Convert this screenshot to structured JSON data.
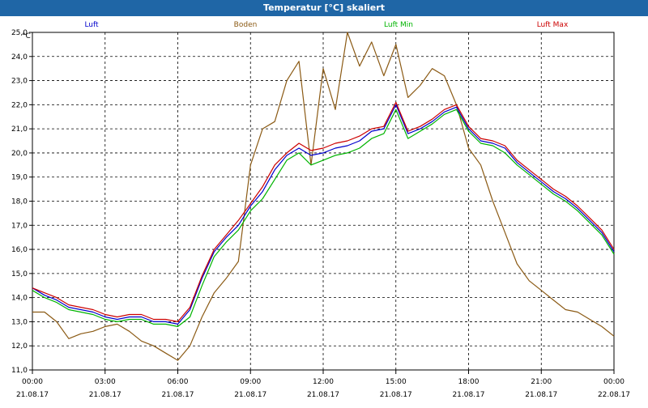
{
  "window": {
    "title": "Temperatur [°C] skaliert"
  },
  "chart_data": {
    "type": "line",
    "title": "Temperatur [°C] skaliert",
    "ylabel": "°C",
    "ylim": [
      11.0,
      25.0
    ],
    "yticks": [
      "11,0",
      "12,0",
      "13,0",
      "14,0",
      "15,0",
      "16,0",
      "17,0",
      "18,0",
      "19,0",
      "20,0",
      "21,0",
      "22,0",
      "23,0",
      "24,0",
      "25,0"
    ],
    "xlim": [
      0,
      24
    ],
    "xticks": [
      {
        "time": "00:00",
        "date": "21.08.17"
      },
      {
        "time": "03:00",
        "date": "21.08.17"
      },
      {
        "time": "06:00",
        "date": "21.08.17"
      },
      {
        "time": "09:00",
        "date": "21.08.17"
      },
      {
        "time": "12:00",
        "date": "21.08.17"
      },
      {
        "time": "15:00",
        "date": "21.08.17"
      },
      {
        "time": "18:00",
        "date": "21.08.17"
      },
      {
        "time": "21:00",
        "date": "21.08.17"
      },
      {
        "time": "00:00",
        "date": "22.08.17"
      }
    ],
    "grid": true,
    "legend_position": "top",
    "series": [
      {
        "name": "Luft",
        "color": "#0000cc",
        "x": [
          0,
          0.5,
          1,
          1.5,
          2,
          2.5,
          3,
          3.5,
          4,
          4.5,
          5,
          5.5,
          6,
          6.5,
          7,
          7.5,
          8,
          8.5,
          9,
          9.5,
          10,
          10.5,
          11,
          11.5,
          12,
          12.5,
          13,
          13.5,
          14,
          14.5,
          15,
          15.5,
          16,
          16.5,
          17,
          17.5,
          18,
          18.5,
          19,
          19.5,
          20,
          20.5,
          21,
          21.5,
          22,
          22.5,
          23,
          23.5,
          24
        ],
        "y": [
          14.4,
          14.1,
          13.9,
          13.6,
          13.5,
          13.4,
          13.2,
          13.1,
          13.2,
          13.2,
          13.0,
          13.0,
          12.9,
          13.5,
          14.8,
          15.9,
          16.5,
          17.0,
          17.8,
          18.4,
          19.3,
          19.9,
          20.2,
          19.9,
          20.0,
          20.2,
          20.3,
          20.5,
          20.9,
          21.0,
          22.0,
          20.8,
          21.0,
          21.3,
          21.7,
          21.9,
          21.0,
          20.5,
          20.4,
          20.2,
          19.6,
          19.2,
          18.8,
          18.4,
          18.1,
          17.7,
          17.2,
          16.7,
          15.9
        ]
      },
      {
        "name": "Boden",
        "color": "#8b5a14",
        "x": [
          0,
          0.5,
          1,
          1.5,
          2,
          2.5,
          3,
          3.5,
          4,
          4.5,
          5,
          5.5,
          6,
          6.5,
          7,
          7.5,
          8,
          8.5,
          9,
          9.5,
          10,
          10.5,
          11,
          11.5,
          12,
          12.5,
          13,
          13.5,
          14,
          14.5,
          15,
          15.5,
          16,
          16.5,
          17,
          17.5,
          18,
          18.5,
          19,
          19.5,
          20,
          20.5,
          21,
          21.5,
          22,
          22.5,
          23,
          23.5,
          24
        ],
        "y": [
          13.4,
          13.4,
          13.0,
          12.3,
          12.5,
          12.6,
          12.8,
          12.9,
          12.6,
          12.2,
          12.0,
          11.7,
          11.4,
          12.0,
          13.2,
          14.2,
          14.8,
          15.5,
          19.5,
          21.0,
          21.3,
          23.0,
          23.8,
          19.5,
          23.5,
          21.8,
          25.0,
          23.6,
          24.6,
          23.2,
          24.5,
          22.3,
          22.8,
          23.5,
          23.2,
          22.0,
          20.2,
          19.5,
          18.0,
          16.7,
          15.4,
          14.7,
          14.3,
          13.9,
          13.5,
          13.4,
          13.1,
          12.8,
          12.4
        ]
      },
      {
        "name": "Luft Min",
        "color": "#00b400",
        "x": [
          0,
          0.5,
          1,
          1.5,
          2,
          2.5,
          3,
          3.5,
          4,
          4.5,
          5,
          5.5,
          6,
          6.5,
          7,
          7.5,
          8,
          8.5,
          9,
          9.5,
          10,
          10.5,
          11,
          11.5,
          12,
          12.5,
          13,
          13.5,
          14,
          14.5,
          15,
          15.5,
          16,
          16.5,
          17,
          17.5,
          18,
          18.5,
          19,
          19.5,
          20,
          20.5,
          21,
          21.5,
          22,
          22.5,
          23,
          23.5,
          24
        ],
        "y": [
          14.3,
          14.0,
          13.8,
          13.5,
          13.4,
          13.3,
          13.1,
          13.0,
          13.1,
          13.1,
          12.9,
          12.9,
          12.8,
          13.2,
          14.5,
          15.7,
          16.3,
          16.8,
          17.6,
          18.1,
          18.9,
          19.7,
          20.0,
          19.5,
          19.7,
          19.9,
          20.0,
          20.2,
          20.6,
          20.8,
          21.8,
          20.6,
          20.9,
          21.2,
          21.6,
          21.8,
          20.9,
          20.4,
          20.3,
          20.0,
          19.5,
          19.1,
          18.7,
          18.3,
          18.0,
          17.6,
          17.1,
          16.6,
          15.8
        ]
      },
      {
        "name": "Luft Max",
        "color": "#cc0000",
        "x": [
          0,
          0.5,
          1,
          1.5,
          2,
          2.5,
          3,
          3.5,
          4,
          4.5,
          5,
          5.5,
          6,
          6.5,
          7,
          7.5,
          8,
          8.5,
          9,
          9.5,
          10,
          10.5,
          11,
          11.5,
          12,
          12.5,
          13,
          13.5,
          14,
          14.5,
          15,
          15.5,
          16,
          16.5,
          17,
          17.5,
          18,
          18.5,
          19,
          19.5,
          20,
          20.5,
          21,
          21.5,
          22,
          22.5,
          23,
          23.5,
          24
        ],
        "y": [
          14.4,
          14.2,
          14.0,
          13.7,
          13.6,
          13.5,
          13.3,
          13.2,
          13.3,
          13.3,
          13.1,
          13.1,
          13.0,
          13.6,
          14.9,
          16.0,
          16.6,
          17.2,
          17.9,
          18.6,
          19.5,
          20.0,
          20.4,
          20.1,
          20.2,
          20.4,
          20.5,
          20.7,
          21.0,
          21.1,
          22.1,
          20.9,
          21.1,
          21.4,
          21.8,
          22.0,
          21.1,
          20.6,
          20.5,
          20.3,
          19.7,
          19.3,
          18.9,
          18.5,
          18.2,
          17.8,
          17.3,
          16.8,
          16.0
        ]
      }
    ]
  }
}
